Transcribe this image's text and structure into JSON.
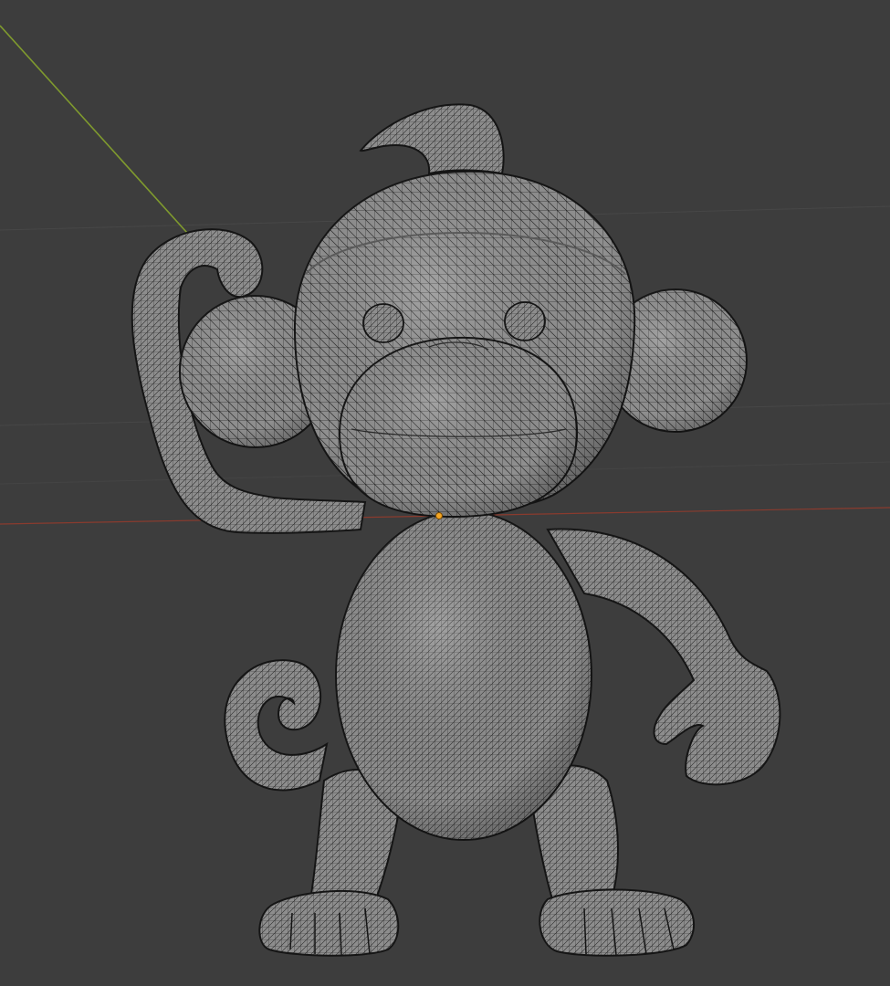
{
  "viewport": {
    "mode": "3d-viewport",
    "shading": "wireframe-over-solid",
    "background_color": "#3d3d3d",
    "grid_line_color": "#4a4a4a",
    "axis_x_color": "#8a3b2e",
    "axis_y_color": "#7f9a2e",
    "object_origin_color": "#f5a623",
    "mesh_fill_color": "#8e8e8e",
    "mesh_wire_color": "#2a2a2a",
    "mesh_outline_color": "#141414"
  },
  "scene": {
    "object": {
      "icon": "monkey-mesh-icon",
      "selected": false,
      "parts": [
        "tuft",
        "head",
        "ears",
        "eyes",
        "muzzle",
        "body",
        "left-arm",
        "right-arm",
        "tail",
        "legs",
        "feet"
      ]
    }
  }
}
